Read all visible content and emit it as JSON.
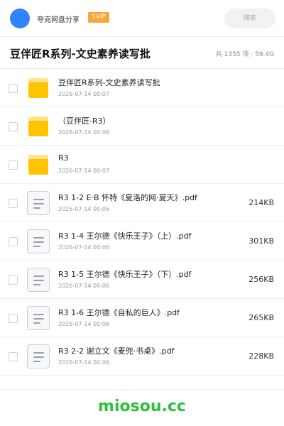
{
  "app": {
    "brand": "夸克网盘分享",
    "badge": "SVIP",
    "search_placeholder": "搜索"
  },
  "folder": {
    "title": "豆伴匠R系列-文史素养读写批",
    "meta": "共 1355 项 · 59.4G"
  },
  "items": [
    {
      "type": "folder",
      "name": "豆伴匠R系列-文史素养读写批",
      "date": "2026-07-14 00:07",
      "size": ""
    },
    {
      "type": "folder",
      "name": "（豆伴匠-R3）",
      "date": "2026-07-14 00:06",
      "size": ""
    },
    {
      "type": "folder",
      "name": "R3",
      "date": "2026-07-14 00:07",
      "size": ""
    },
    {
      "type": "pdf",
      "name": "R3 1-2 E·B 怀特《夏洛的网·夏天》.pdf",
      "date": "2026-07-14 00:06",
      "size": "214KB"
    },
    {
      "type": "pdf",
      "name": "R3 1-4 王尔德《快乐王子》（上）.pdf",
      "date": "2026-07-14 00:06",
      "size": "301KB"
    },
    {
      "type": "pdf",
      "name": "R3 1-5 王尔德《快乐王子》（下）.pdf",
      "date": "2026-07-14 00:06",
      "size": "256KB"
    },
    {
      "type": "pdf",
      "name": "R3 1-6 王尔德《自私的巨人》.pdf",
      "date": "2026-07-14 00:06",
      "size": "265KB"
    },
    {
      "type": "pdf",
      "name": "R3 2-2 谢立文《麦兜·书桌》.pdf",
      "date": "2026-07-14 00:06",
      "size": "228KB"
    }
  ],
  "watermark": "miosou.cc",
  "colors": {
    "accent": "#2d86ff",
    "svip": "#f9a33b",
    "folder": "#ffc300",
    "watermark": "#2fbf3a"
  }
}
